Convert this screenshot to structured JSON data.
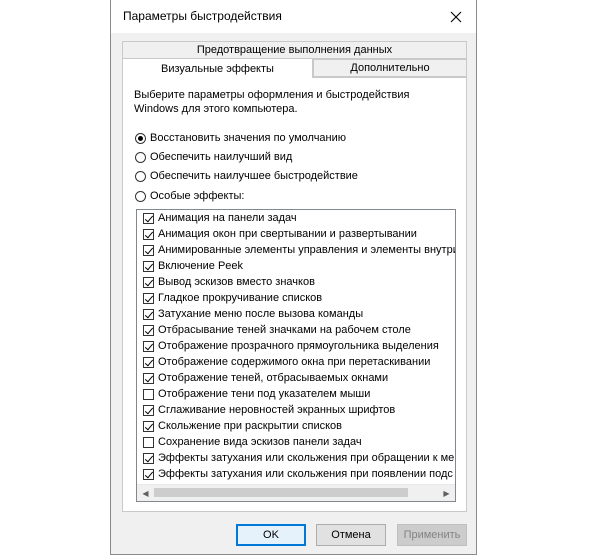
{
  "window": {
    "title": "Параметры быстродействия"
  },
  "tabs": {
    "row1": "Предотвращение выполнения данных",
    "visual": "Визуальные эффекты",
    "additional": "Дополнительно"
  },
  "description": {
    "line1": "Выберите параметры оформления и быстродействия",
    "line2": "Windows для этого компьютера."
  },
  "radios": [
    {
      "label": "Восстановить значения по умолчанию",
      "selected": true
    },
    {
      "label": "Обеспечить наилучший вид",
      "selected": false
    },
    {
      "label": "Обеспечить наилучшее быстродействие",
      "selected": false
    },
    {
      "label": "Особые эффекты:",
      "selected": false
    }
  ],
  "effects": [
    {
      "label": "Анимация на панели задач",
      "checked": true
    },
    {
      "label": "Анимация окон при свертывании и развертывании",
      "checked": true
    },
    {
      "label": "Анимированные элементы управления и элементы внутри",
      "checked": true
    },
    {
      "label": "Включение Peek",
      "checked": true
    },
    {
      "label": "Вывод эскизов вместо значков",
      "checked": true
    },
    {
      "label": "Гладкое прокручивание списков",
      "checked": true
    },
    {
      "label": "Затухание меню после вызова команды",
      "checked": true
    },
    {
      "label": "Отбрасывание теней значками на рабочем столе",
      "checked": true
    },
    {
      "label": "Отображение прозрачного прямоугольника выделения",
      "checked": true
    },
    {
      "label": "Отображение содержимого окна при перетаскивании",
      "checked": true
    },
    {
      "label": "Отображение теней, отбрасываемых окнами",
      "checked": true
    },
    {
      "label": "Отображение тени под указателем мыши",
      "checked": false
    },
    {
      "label": "Сглаживание неровностей экранных шрифтов",
      "checked": true
    },
    {
      "label": "Скольжение при раскрытии списков",
      "checked": true
    },
    {
      "label": "Сохранение вида эскизов панели задач",
      "checked": false
    },
    {
      "label": "Эффекты затухания или скольжения при обращении к ме",
      "checked": true
    },
    {
      "label": "Эффекты затухания или скольжения при появлении подс",
      "checked": true
    }
  ],
  "buttons": {
    "ok": "OK",
    "cancel": "Отмена",
    "apply": "Применить"
  },
  "icons": {
    "close": "close-icon",
    "scroll_left": "scroll-left-icon",
    "scroll_right": "scroll-right-icon"
  }
}
